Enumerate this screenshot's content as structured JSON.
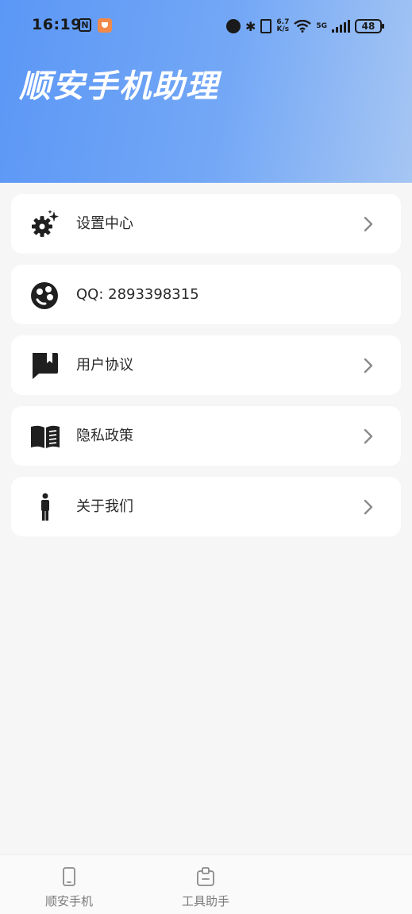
{
  "status_bar": {
    "time": "16:19",
    "net_speed_top": "6.7",
    "net_speed_bottom": "K/s",
    "network": "5G",
    "battery": "48",
    "icons": [
      "nfc-icon",
      "app-badge-icon",
      "alarm-icon",
      "bluetooth-icon",
      "vibrate-icon",
      "wifi-icon",
      "signal-icon",
      "battery-icon"
    ]
  },
  "header": {
    "title": "顺安手机助理",
    "gradient_start": "#5b97f6",
    "gradient_end": "#a6c6f3"
  },
  "menu": {
    "items": [
      {
        "label": "设置中心",
        "icon": "settings-gear-icon",
        "has_chevron": true
      },
      {
        "label": "QQ: 2893398315",
        "icon": "qq-icon",
        "has_chevron": false
      },
      {
        "label": "用户协议",
        "icon": "bookmark-chat-icon",
        "has_chevron": true
      },
      {
        "label": "隐私政策",
        "icon": "open-book-icon",
        "has_chevron": true
      },
      {
        "label": "关于我们",
        "icon": "person-icon",
        "has_chevron": true
      }
    ]
  },
  "bottom_nav": {
    "tabs": [
      {
        "label": "顺安手机",
        "icon": "phone-icon"
      },
      {
        "label": "工具助手",
        "icon": "toolbox-icon"
      }
    ]
  },
  "colors": {
    "page_background": "#f6f6f6",
    "card_background": "#ffffff",
    "icon_color": "#1f1f1f",
    "text_color": "#2a2a2a"
  }
}
